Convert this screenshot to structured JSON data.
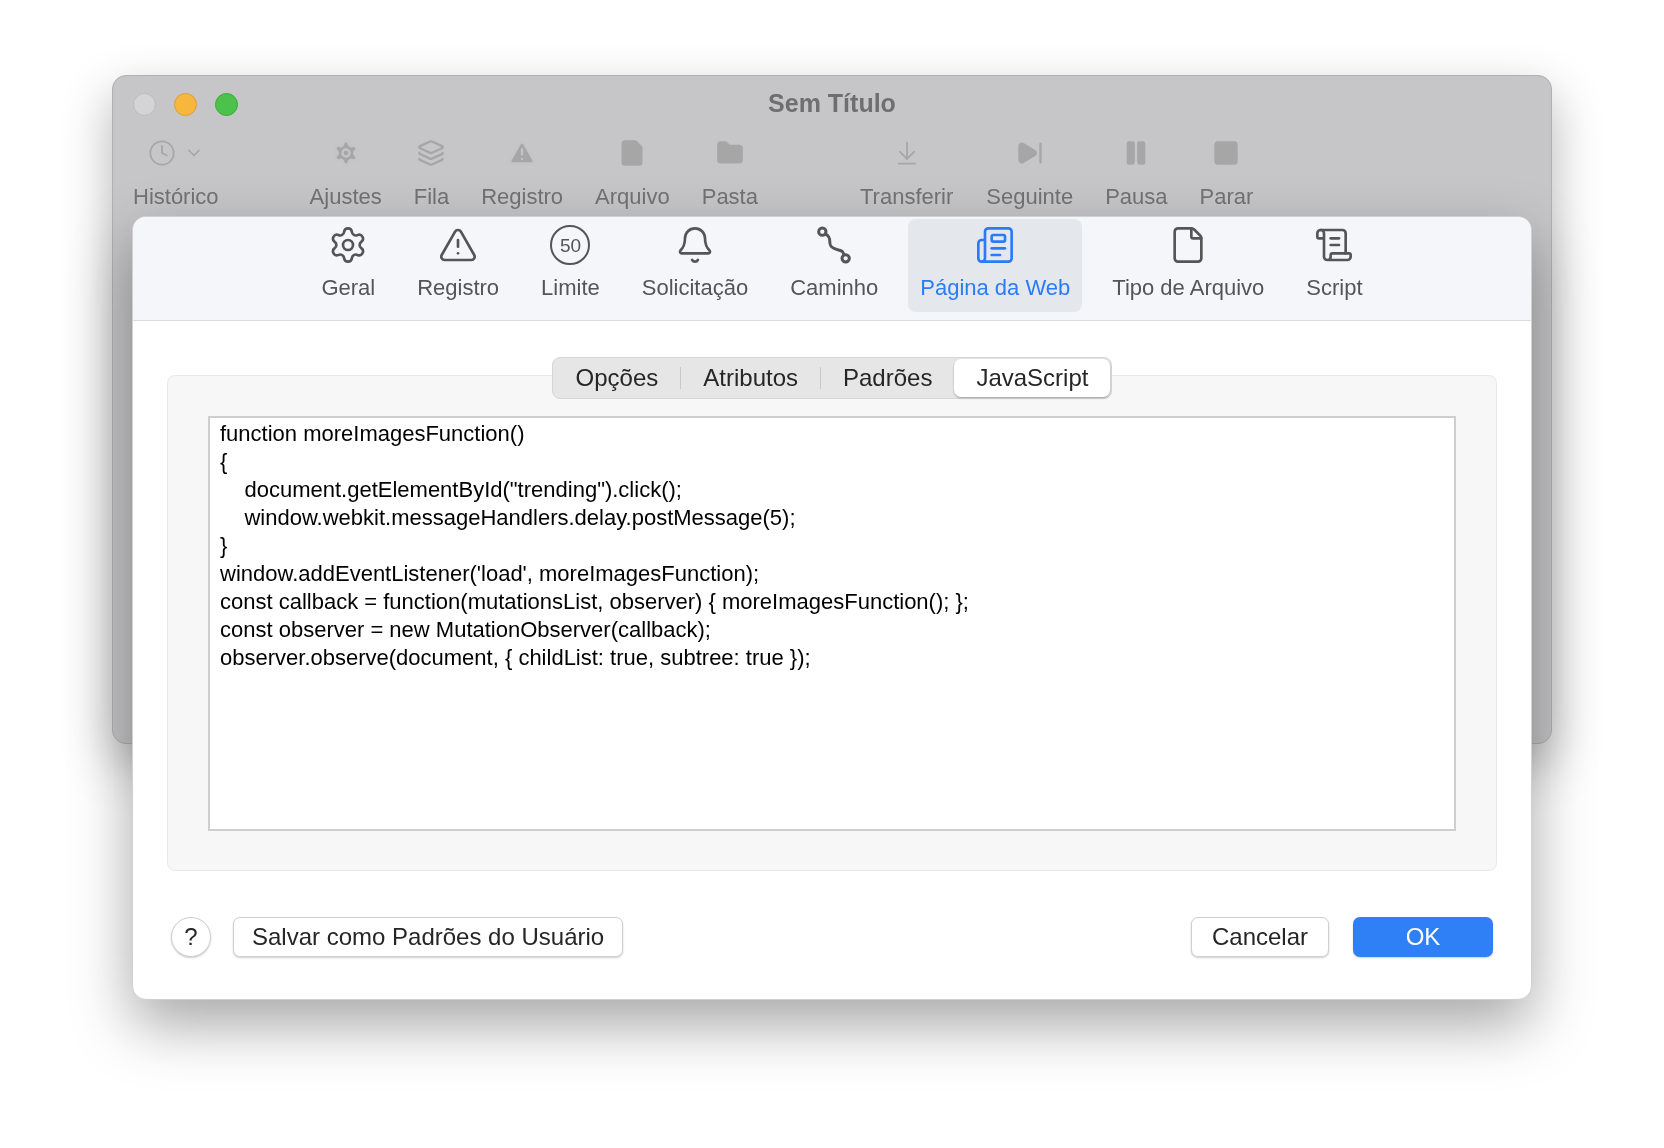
{
  "window": {
    "title": "Sem Título"
  },
  "toolbar": [
    {
      "kind": "history",
      "label": "Histórico"
    },
    {
      "kind": "gear",
      "label": "Ajustes"
    },
    {
      "kind": "layers",
      "label": "Fila"
    },
    {
      "kind": "warning",
      "label": "Registro"
    },
    {
      "kind": "file",
      "label": "Arquivo"
    },
    {
      "kind": "folder",
      "label": "Pasta"
    },
    {
      "kind": "download",
      "label": "Transferir"
    },
    {
      "kind": "next",
      "label": "Seguinte"
    },
    {
      "kind": "pause",
      "label": "Pausa"
    },
    {
      "kind": "stop",
      "label": "Parar"
    }
  ],
  "preferences": {
    "panes": [
      {
        "kind": "gear",
        "label": "Geral",
        "selected": false
      },
      {
        "kind": "warning",
        "label": "Registro",
        "selected": false
      },
      {
        "kind": "limit",
        "label": "Limite",
        "badge": "50",
        "selected": false
      },
      {
        "kind": "bell",
        "label": "Solicitação",
        "selected": false
      },
      {
        "kind": "path",
        "label": "Caminho",
        "selected": false
      },
      {
        "kind": "webpage",
        "label": "Página da Web",
        "selected": true
      },
      {
        "kind": "file",
        "label": "Tipo de Arquivo",
        "selected": false
      },
      {
        "kind": "script",
        "label": "Script",
        "selected": false
      }
    ],
    "tabs": [
      {
        "label": "Opções",
        "selected": false
      },
      {
        "label": "Atributos",
        "selected": false
      },
      {
        "label": "Padrões",
        "selected": false
      },
      {
        "label": "JavaScript",
        "selected": true
      }
    ],
    "code": [
      "function moreImagesFunction()",
      "{",
      "    document.getElementById(\"trending\").click();",
      "    window.webkit.messageHandlers.delay.postMessage(5);",
      "}",
      "window.addEventListener('load', moreImagesFunction);",
      "const callback = function(mutationsList, observer) { moreImagesFunction(); };",
      "const observer = new MutationObserver(callback);",
      "observer.observe(document, { childList: true, subtree: true });"
    ],
    "help": "?",
    "save_defaults": "Salvar como Padrões do Usuário",
    "cancel": "Cancelar",
    "ok": "OK"
  }
}
